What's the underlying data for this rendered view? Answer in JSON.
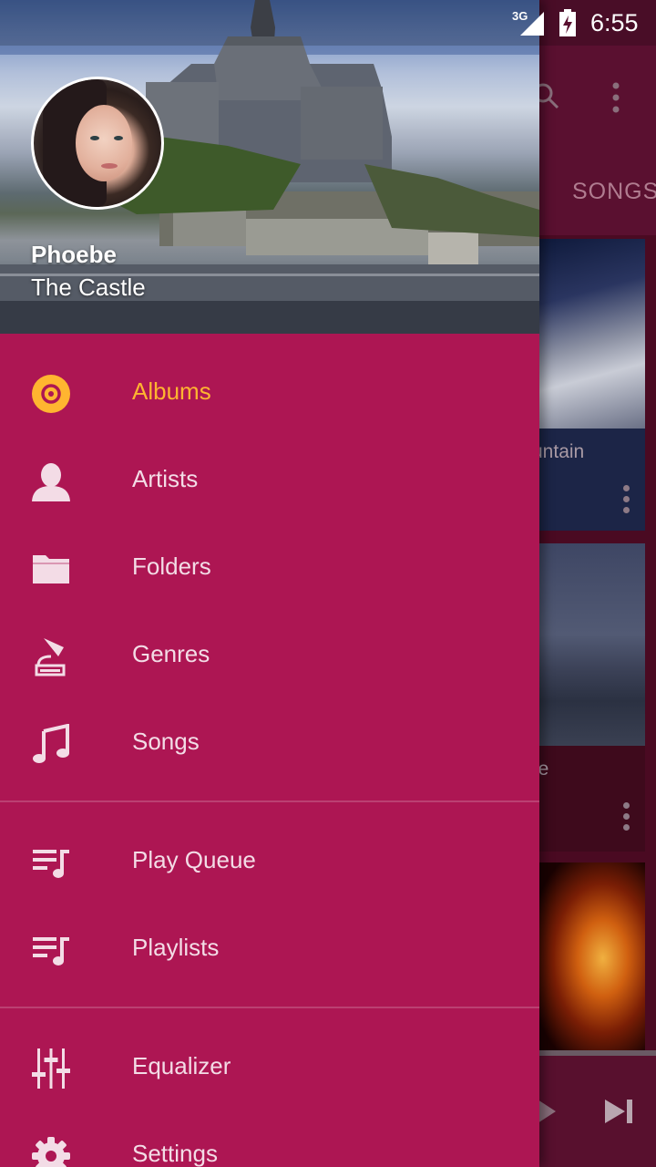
{
  "status_bar": {
    "network": "3G",
    "time": "6:55"
  },
  "background_app": {
    "visible_tab": "SONGS",
    "cards": [
      {
        "title": "untain"
      },
      {
        "title": "le"
      },
      {
        "title": ""
      }
    ]
  },
  "drawer": {
    "user": {
      "name": "Phoebe",
      "subtitle": "The Castle"
    },
    "items": [
      {
        "label": "Albums",
        "icon": "album-icon",
        "active": true
      },
      {
        "label": "Artists",
        "icon": "artist-icon"
      },
      {
        "label": "Folders",
        "icon": "folder-icon"
      },
      {
        "label": "Genres",
        "icon": "gramophone-icon"
      },
      {
        "label": "Songs",
        "icon": "music-note-icon"
      },
      {
        "label": "Play Queue",
        "icon": "queue-music-icon"
      },
      {
        "label": "Playlists",
        "icon": "playlist-icon"
      },
      {
        "label": "Equalizer",
        "icon": "equalizer-icon"
      },
      {
        "label": "Settings",
        "icon": "gear-icon"
      }
    ]
  },
  "colors": {
    "drawer_bg": "#ad1653",
    "active": "#ffb530",
    "text": "#f3dce6"
  }
}
